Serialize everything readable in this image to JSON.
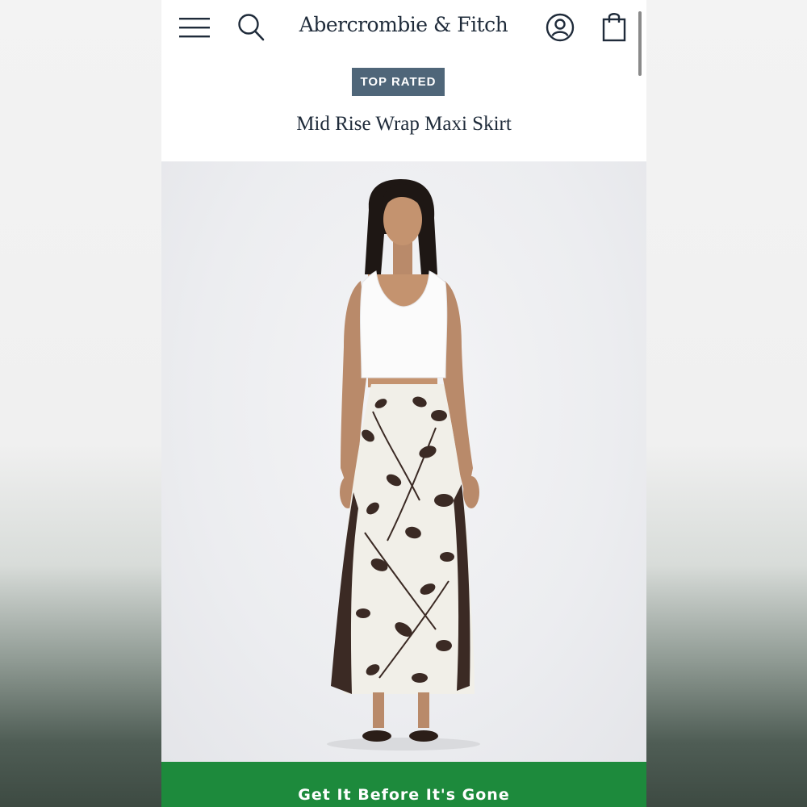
{
  "header": {
    "brand": "Abercrombie & Fitch",
    "icons": [
      "menu-icon",
      "search-icon",
      "account-icon",
      "shopping-bag-icon"
    ]
  },
  "product": {
    "badge": "TOP RATED",
    "title": "Mid Rise Wrap Maxi Skirt",
    "image_subject": "model-wearing-floral-wrap-maxi-skirt"
  },
  "cta": {
    "label": "Get It Before It's Gone"
  },
  "colors": {
    "brand_text": "#1f2b3a",
    "badge_bg": "#4f6679",
    "cta_bg": "#1d8a3c",
    "print_dark": "#3b2a24",
    "print_light": "#f1efe8"
  }
}
